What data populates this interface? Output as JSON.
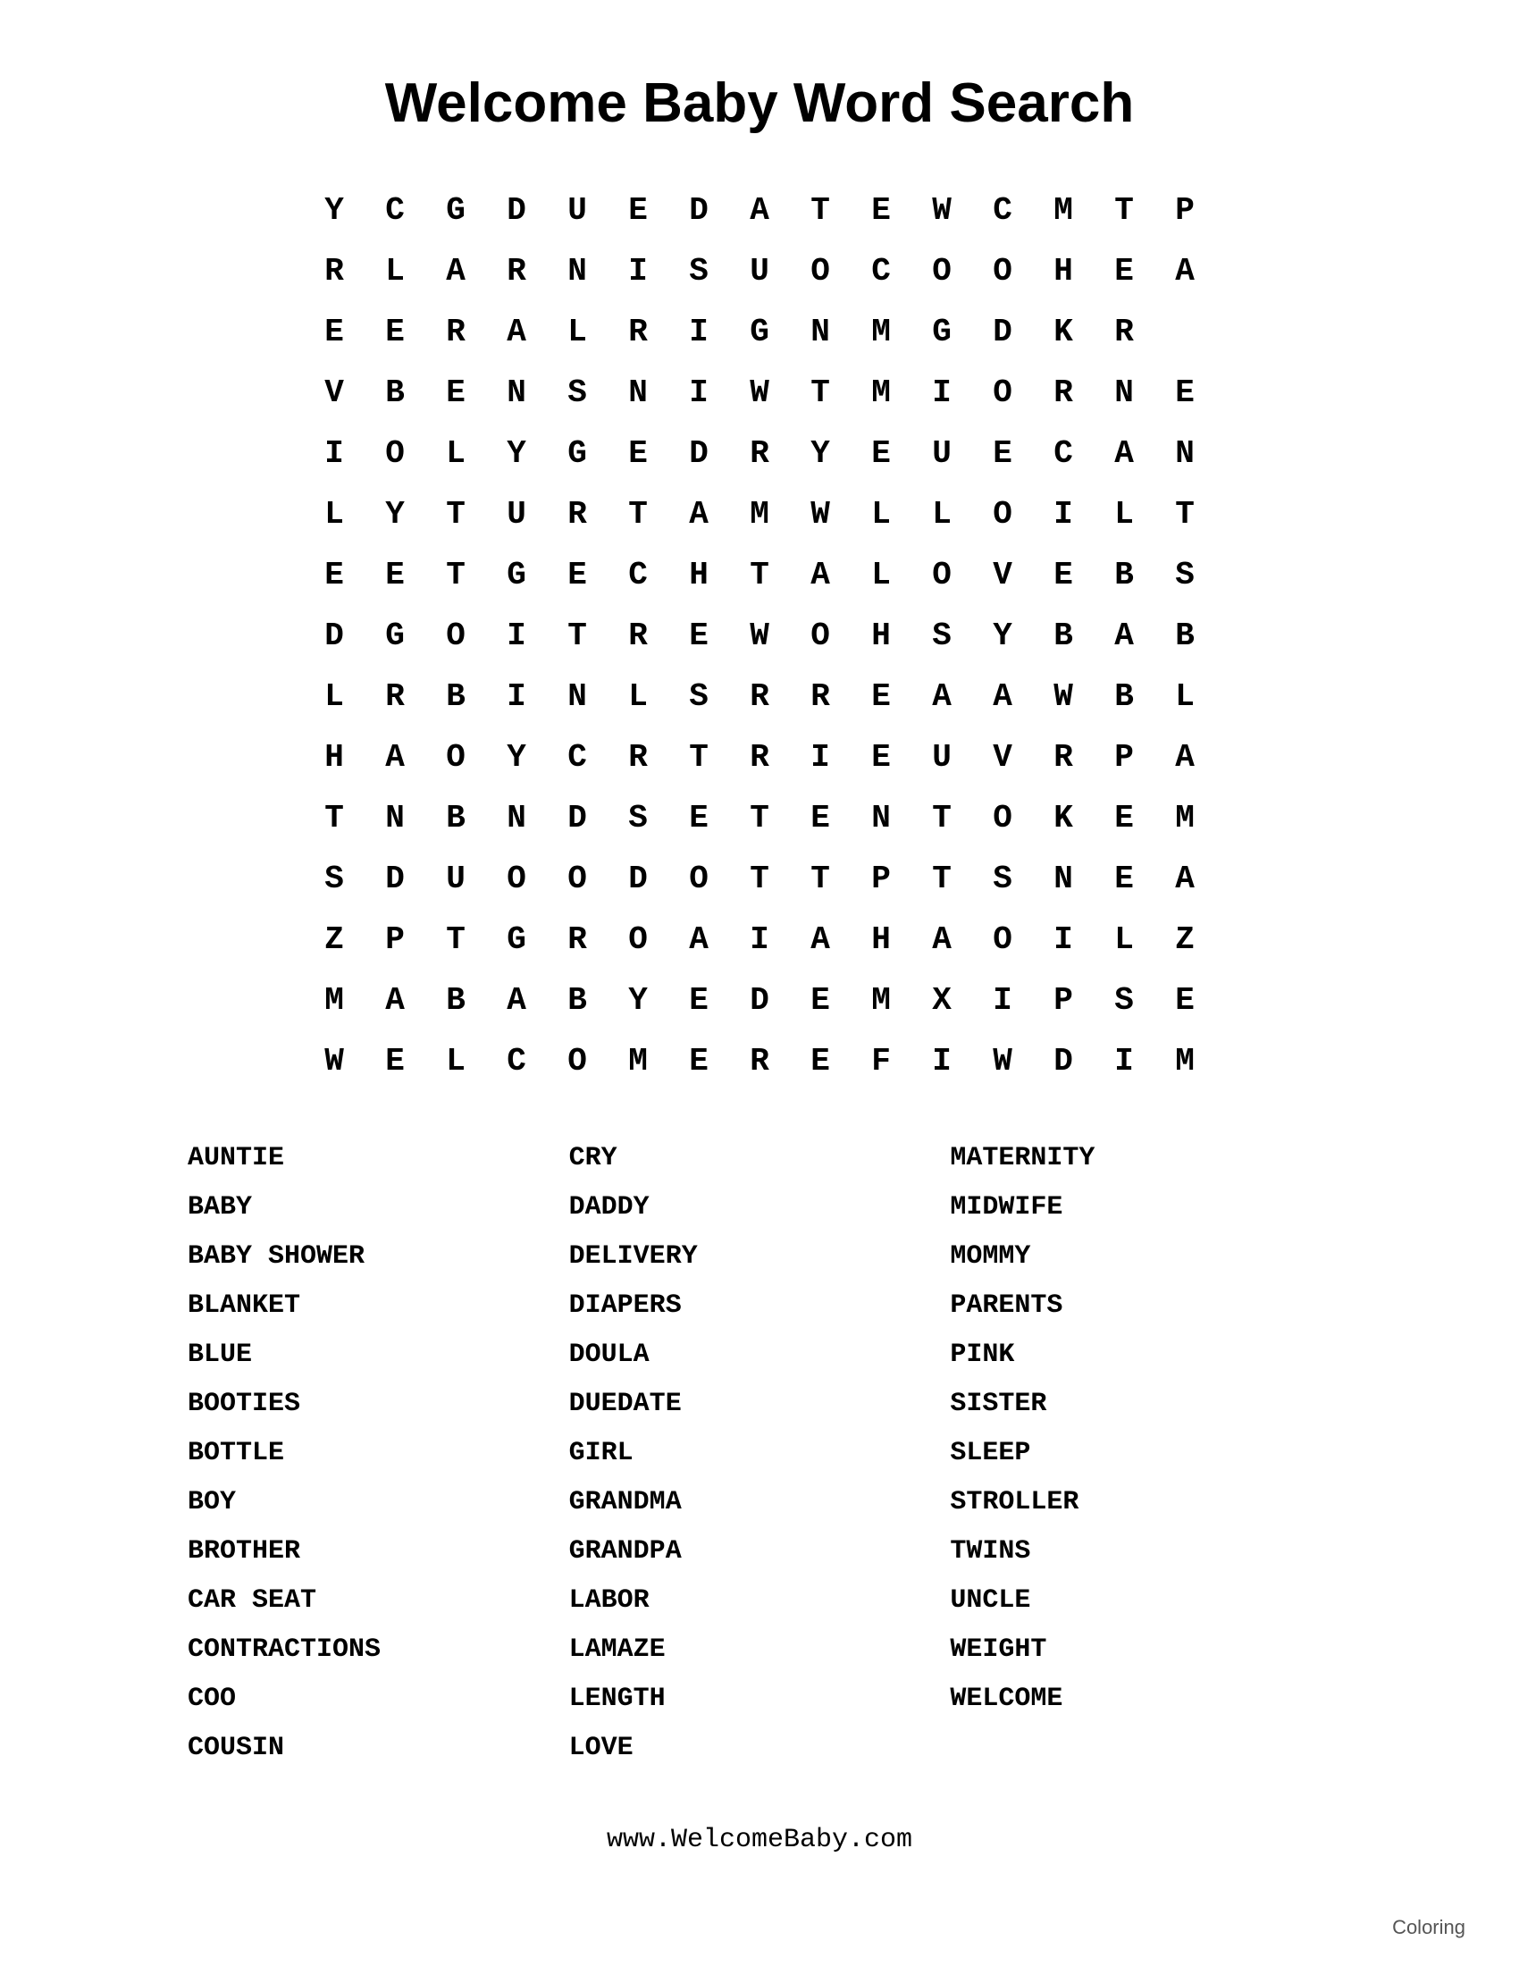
{
  "page": {
    "title": "Welcome Baby Word Search",
    "grid": [
      [
        "Y",
        "C",
        "G",
        "D",
        "U",
        "E",
        "D",
        "A",
        "T",
        "E",
        "W",
        "C",
        "M",
        "T",
        "P"
      ],
      [
        "R",
        "L",
        "A",
        "R",
        "N",
        "I",
        "S",
        "U",
        "O",
        "C",
        "O",
        "O",
        "H",
        "E",
        "A"
      ],
      [
        "E",
        "E",
        "R",
        "A",
        "L",
        "R",
        "I",
        "G",
        "N",
        "M",
        "G",
        "D",
        "K",
        "R",
        ""
      ],
      [
        "V",
        "B",
        "E",
        "N",
        "S",
        "N",
        "I",
        "W",
        "T",
        "M",
        "I",
        "O",
        "R",
        "N",
        "E"
      ],
      [
        "I",
        "O",
        "L",
        "Y",
        "G",
        "E",
        "D",
        "R",
        "Y",
        "E",
        "U",
        "E",
        "C",
        "A",
        "N"
      ],
      [
        "L",
        "Y",
        "T",
        "U",
        "R",
        "T",
        "A",
        "M",
        "W",
        "L",
        "L",
        "O",
        "I",
        "L",
        "T"
      ],
      [
        "E",
        "E",
        "T",
        "G",
        "E",
        "C",
        "H",
        "T",
        "A",
        "L",
        "O",
        "V",
        "E",
        "B",
        "S"
      ],
      [
        "D",
        "G",
        "O",
        "I",
        "T",
        "R",
        "E",
        "W",
        "O",
        "H",
        "S",
        "Y",
        "B",
        "A",
        "B"
      ],
      [
        "L",
        "R",
        "B",
        "I",
        "N",
        "L",
        "S",
        "R",
        "R",
        "E",
        "A",
        "A",
        "W",
        "B",
        "L"
      ],
      [
        "H",
        "A",
        "O",
        "Y",
        "C",
        "R",
        "T",
        "R",
        "I",
        "E",
        "U",
        "V",
        "R",
        "P",
        "A"
      ],
      [
        "T",
        "N",
        "B",
        "N",
        "D",
        "S",
        "E",
        "T",
        "E",
        "N",
        "T",
        "O",
        "K",
        "E",
        "M"
      ],
      [
        "S",
        "D",
        "U",
        "O",
        "O",
        "D",
        "O",
        "T",
        "T",
        "P",
        "T",
        "S",
        "N",
        "E",
        "A"
      ],
      [
        "Z",
        "P",
        "T",
        "G",
        "R",
        "O",
        "A",
        "I",
        "A",
        "H",
        "A",
        "O",
        "I",
        "L",
        "Z"
      ],
      [
        "M",
        "A",
        "B",
        "A",
        "B",
        "Y",
        "E",
        "D",
        "E",
        "M",
        "X",
        "I",
        "P",
        "S",
        "E"
      ],
      [
        "W",
        "E",
        "L",
        "C",
        "O",
        "M",
        "E",
        "R",
        "E",
        "F",
        "I",
        "W",
        "D",
        "I",
        "M"
      ]
    ],
    "word_columns": [
      {
        "words": [
          "AUNTIE",
          "BABY",
          "BABY SHOWER",
          "BLANKET",
          "BLUE",
          "BOOTIES",
          "BOTTLE",
          "BOY",
          "BROTHER",
          "CAR SEAT",
          "CONTRACTIONS",
          "COO",
          "COUSIN"
        ]
      },
      {
        "words": [
          "CRY",
          "DADDY",
          "DELIVERY",
          "DIAPERS",
          "DOULA",
          "DUEDATE",
          "GIRL",
          "GRANDMA",
          "GRANDPA",
          "LABOR",
          "LAMAZE",
          "LENGTH",
          "LOVE"
        ]
      },
      {
        "words": [
          "MATERNITY",
          "MIDWIFE",
          "MOMMY",
          "PARENTS",
          "PINK",
          "SISTER",
          "SLEEP",
          "STROLLER",
          "TWINS",
          "UNCLE",
          "WEIGHT",
          "WELCOME"
        ]
      }
    ],
    "footer_url": "www.WelcomeBaby.com",
    "coloring_label": "Coloring"
  }
}
